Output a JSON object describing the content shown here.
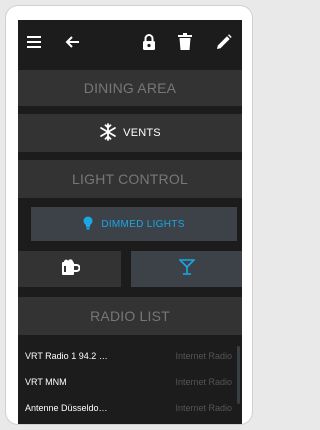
{
  "topbar": {
    "icons": [
      "menu-icon",
      "back-arrow-icon",
      "lock-icon",
      "trash-icon",
      "edit-pencil-icon"
    ]
  },
  "tiles": {
    "dining_area": "DINING AREA",
    "vents": "VENTS",
    "light_control": "LIGHT CONTROL",
    "dimmed_lights": "DIMMED LIGHTS",
    "radio_list": "RADIO LIST"
  },
  "radio": [
    {
      "name": "VRT Radio 1 94.2 …",
      "type": "Internet Radio"
    },
    {
      "name": "VRT MNM",
      "type": "Internet Radio"
    },
    {
      "name": "Antenne Düsseldo…",
      "type": "Internet Radio"
    }
  ],
  "colors": {
    "accent": "#1aa7e8",
    "tile": "#333333",
    "background": "#1c1c1c"
  }
}
